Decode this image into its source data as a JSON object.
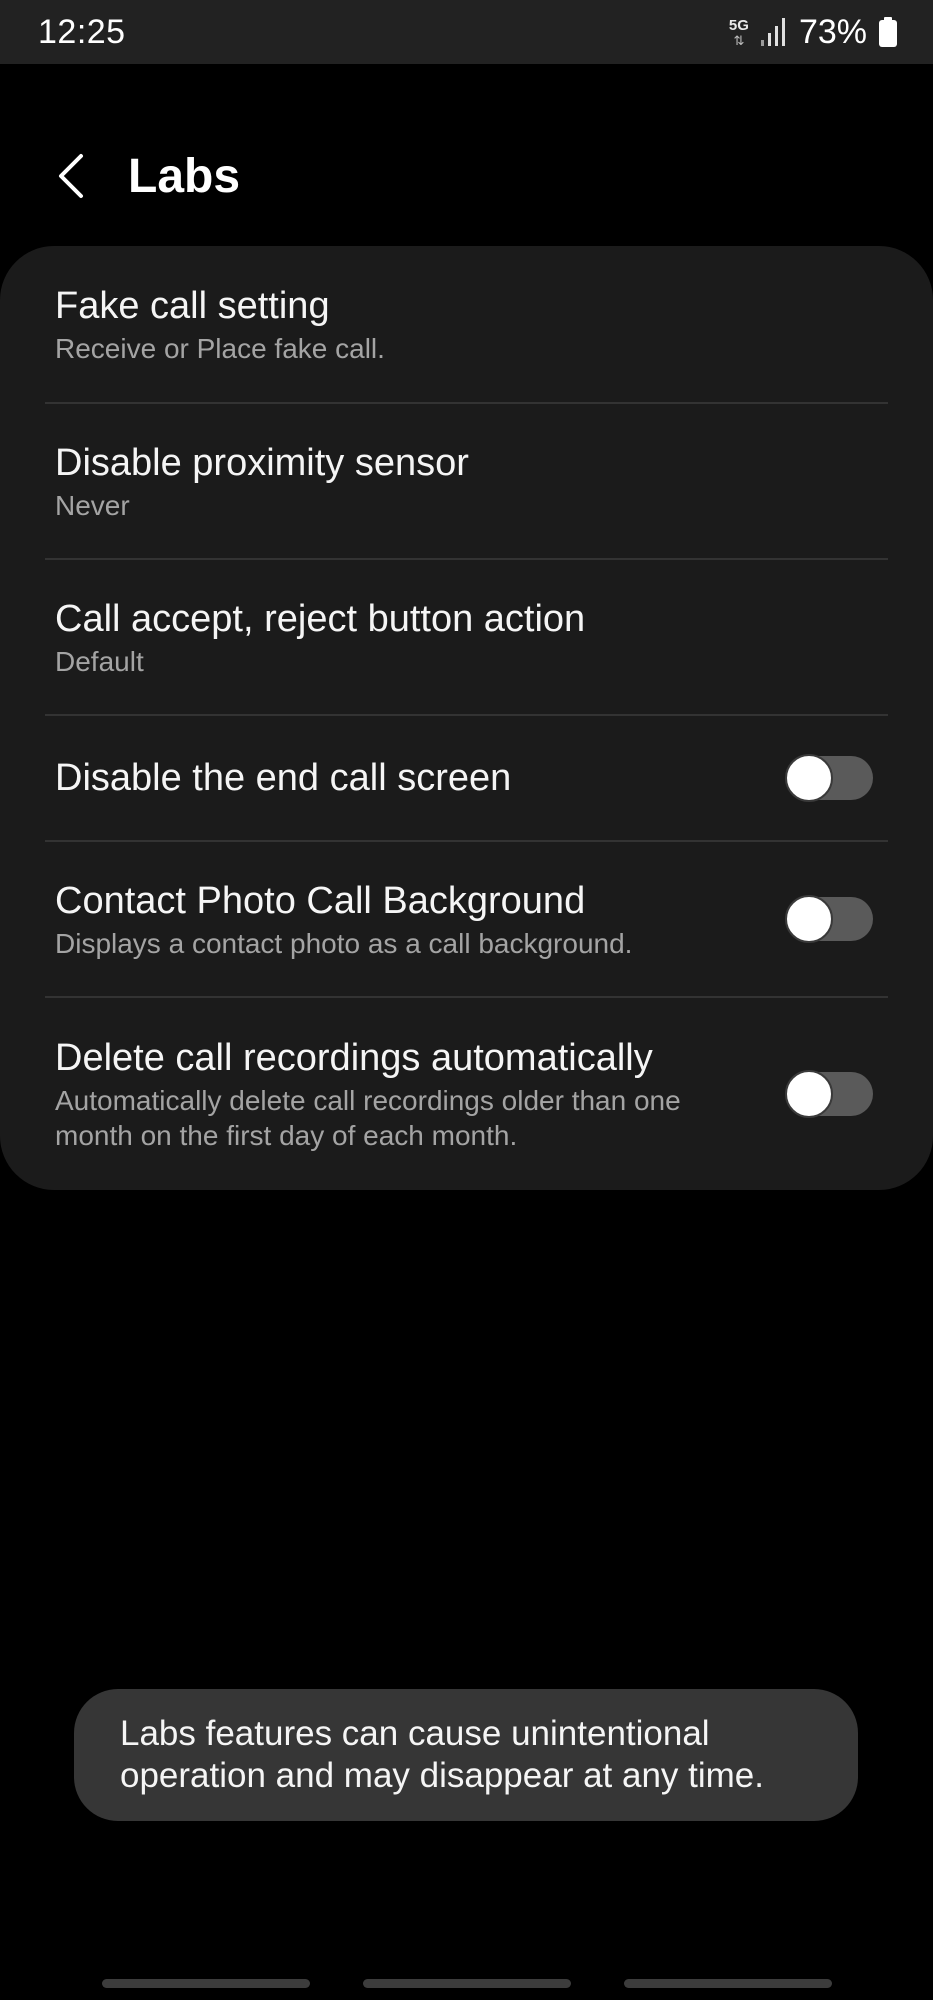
{
  "status_bar": {
    "time": "12:25",
    "network_type": "5G",
    "network_arrows": "⇅",
    "battery_percent": "73%"
  },
  "header": {
    "title": "Labs",
    "back_icon": "chevron-left-icon"
  },
  "settings": [
    {
      "title": "Fake call setting",
      "subtitle": "Receive or Place fake call."
    },
    {
      "title": "Disable proximity sensor",
      "subtitle": "Never"
    },
    {
      "title": "Call accept, reject button action",
      "subtitle": "Default"
    },
    {
      "title": "Disable the end call screen",
      "toggle": false
    },
    {
      "title": "Contact Photo Call Background",
      "subtitle": "Displays a contact photo as a call background.",
      "toggle": false
    },
    {
      "title": "Delete call recordings automatically",
      "subtitle_line1": "Automatically delete call recordings older than one",
      "subtitle_line2": "month on the first day of each month.",
      "toggle": false
    }
  ],
  "toast": {
    "line1": "Labs features can cause unintentional",
    "line2": "operation and may disappear at any time."
  },
  "colors": {
    "background": "#000000",
    "card": "#1b1b1b",
    "toast": "#363636",
    "toggle_off_track": "#5a5a5a"
  }
}
